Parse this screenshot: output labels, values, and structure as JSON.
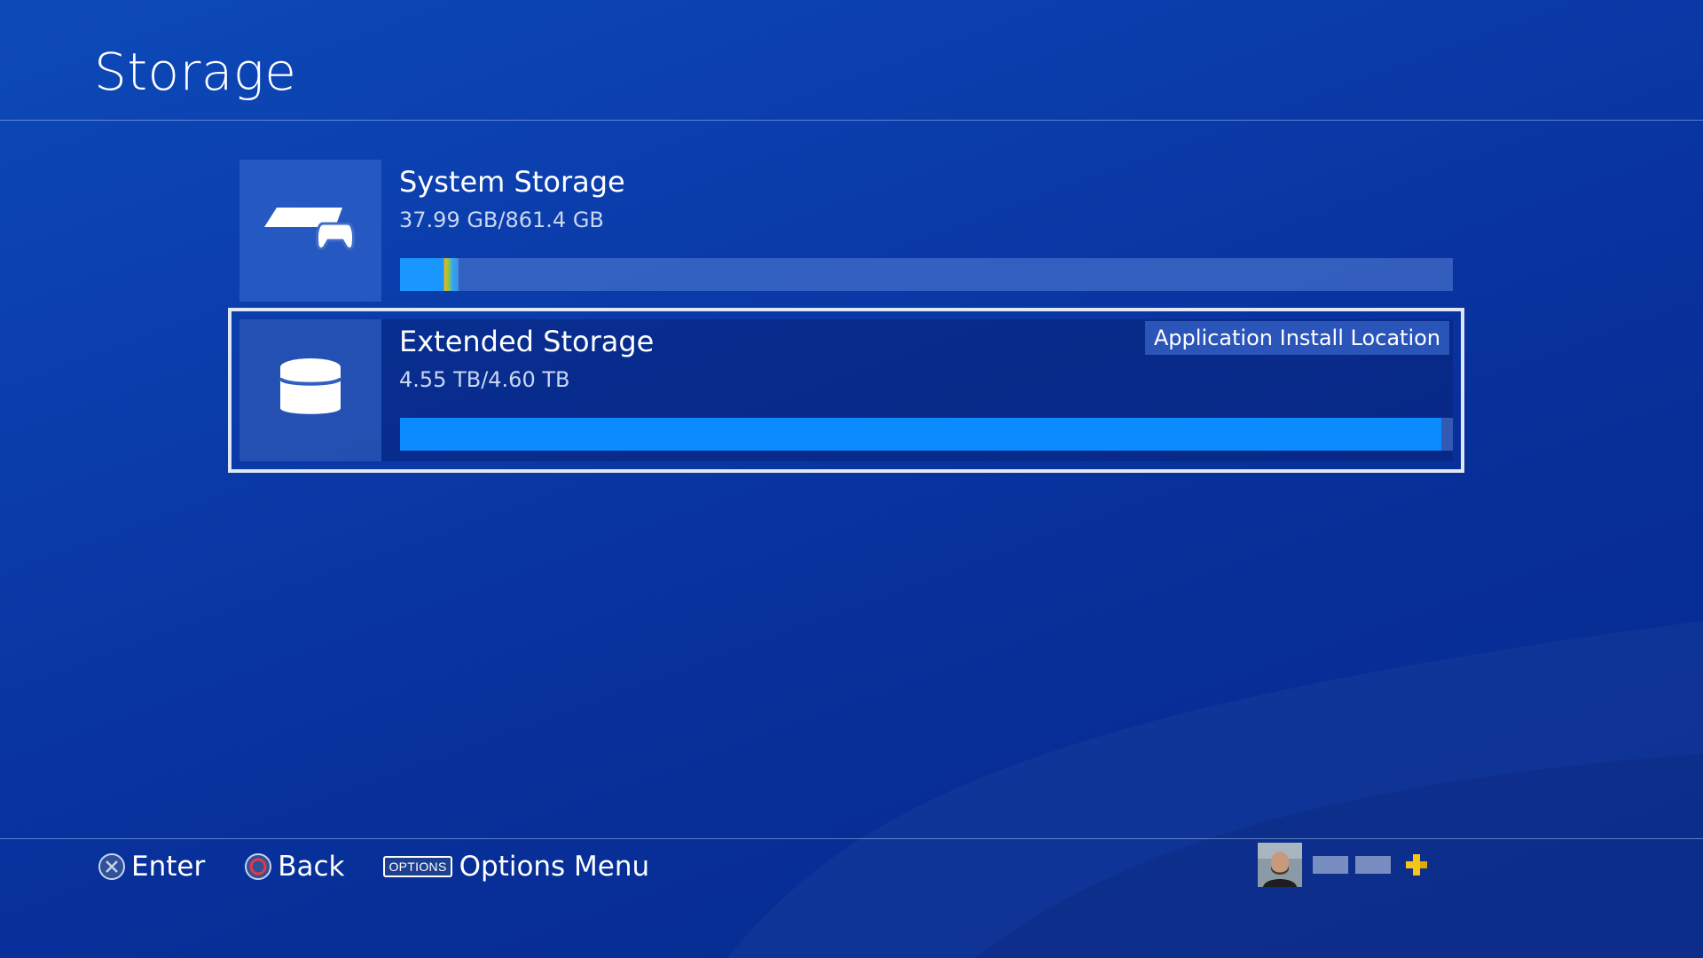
{
  "page": {
    "title": "Storage"
  },
  "storage_items": [
    {
      "name": "System Storage",
      "usage": "37.99 GB/861.4 GB",
      "used_fraction": 0.056,
      "icon": "console-controller-icon",
      "selected": false,
      "badge": ""
    },
    {
      "name": "Extended Storage",
      "usage": "4.55 TB/4.60 TB",
      "used_fraction": 0.989,
      "icon": "disk-drive-icon",
      "selected": true,
      "badge": "Application Install Location"
    }
  ],
  "footer": {
    "hints": [
      {
        "icon": "cross-button-icon",
        "label": "Enter"
      },
      {
        "icon": "circle-button-icon",
        "label": "Back"
      },
      {
        "icon": "options-button-icon",
        "key_label": "OPTIONS",
        "label": "Options Menu"
      }
    ]
  },
  "user": {
    "plus_icon": "ps-plus-icon",
    "plus_color": "#f5c518"
  },
  "colors": {
    "accent_bar": "#0a8cff",
    "background": "#0a3aa8"
  }
}
